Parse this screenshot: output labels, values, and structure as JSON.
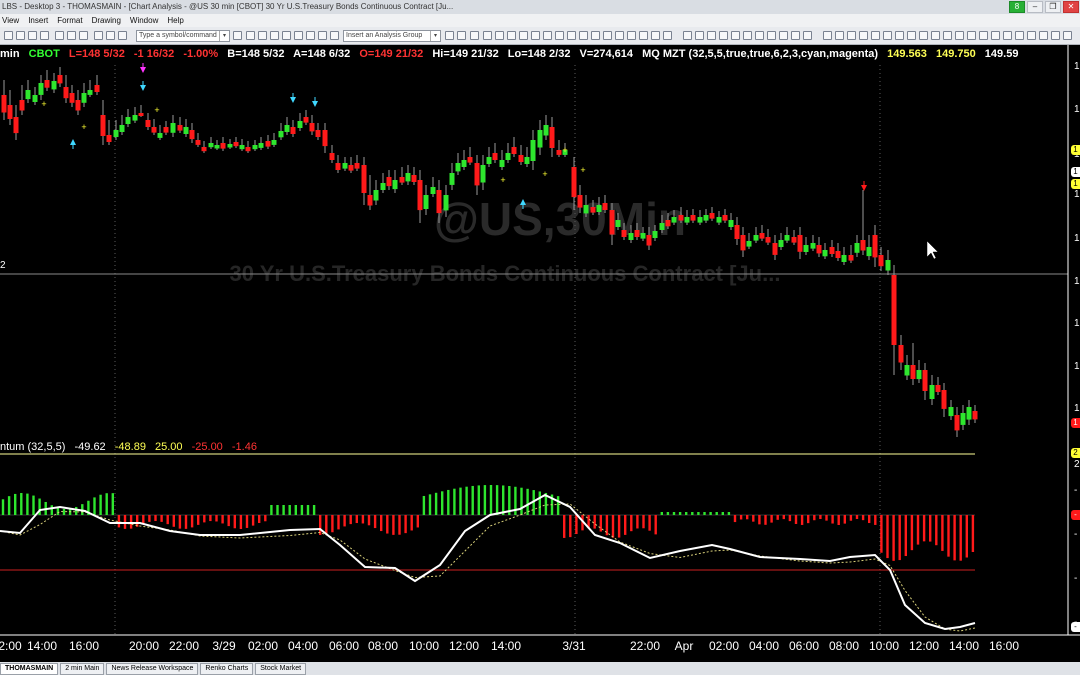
{
  "window": {
    "title": "LBS - Desktop 3 - THOMASMAIN - [Chart Analysis - @US 30 min [CBOT] 30 Yr U.S.Treasury Bonds Continuous Contract [Ju...",
    "badge": "8",
    "min_glyph": "–",
    "max_glyph": "❐",
    "close_glyph": "✕"
  },
  "menu": {
    "items": [
      "View",
      "Insert",
      "Format",
      "Drawing",
      "Window",
      "Help"
    ]
  },
  "toolbar": {
    "symbol_placeholder": "Type a symbol/command",
    "analysis_group_placeholder": "Insert an Analysis Group",
    "dropdown_glyph": "▾"
  },
  "info": {
    "interval": "min",
    "exchange": "CBOT",
    "last": "L=148 5/32",
    "change": "-1 16/32",
    "change_pct": "-1.00%",
    "bid": "B=148 5/32",
    "ask": "A=148 6/32",
    "open": "O=149 21/32",
    "high": "Hi=149 21/32",
    "low": "Lo=148 2/32",
    "volume": "V=274,614",
    "study": "MQ MZT (32,5,5,true,true,6,2,3,cyan,magenta)",
    "study_val1": "149.563",
    "study_val2": "149.750",
    "study_val3": "149.59",
    "hline_tag": "2"
  },
  "watermark": {
    "symbol": "@US,30Min",
    "description": "30 Yr U.S.Treasury Bonds Continuous Contract [Ju..."
  },
  "indicator": {
    "name": "ntum (32,5,5)",
    "v1": "-49.62",
    "v2": "-48.89",
    "v3": "25.00",
    "v4": "-25.00",
    "v5": "-1.46"
  },
  "axis": {
    "time_labels": [
      "2:00",
      "14:00",
      "16:00",
      "20:00",
      "22:00",
      "3/29",
      "02:00",
      "04:00",
      "06:00",
      "08:00",
      "10:00",
      "12:00",
      "14:00",
      "3/31",
      "22:00",
      "Apr",
      "02:00",
      "04:00",
      "06:00",
      "08:00",
      "10:00",
      "12:00",
      "14:00",
      "16:00"
    ],
    "price_tags": [
      "1",
      "1",
      "1",
      "1",
      "1",
      "1",
      "1",
      "1",
      "1"
    ],
    "ind_tags": [
      "2",
      "-",
      "-",
      "-",
      "-"
    ]
  },
  "right_pills": [
    "1",
    "1",
    "1",
    "1"
  ],
  "right_ind_pills": [
    "2",
    "-",
    "-"
  ],
  "colors": {
    "up": "#2ee62e",
    "down": "#ff1a1a",
    "cyan": "#3fd8ff",
    "magenta": "#ff33ff",
    "yellow": "#ffff33",
    "info_green": "#33ff33",
    "info_red": "#ff3333",
    "info_yellow": "#ffff55",
    "info_white": "#ffffff"
  },
  "bottom_tabs": [
    "THOMASMAIN",
    "2 min Main",
    "News Release Workspace",
    "Renko Charts",
    "Stock Market"
  ]
}
